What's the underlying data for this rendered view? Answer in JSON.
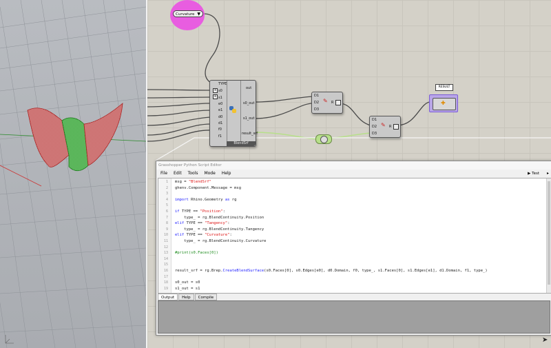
{
  "canvas": {
    "curvature_value": "Curvature",
    "result_label": "RESULT"
  },
  "blend_node": {
    "inputs": [
      "TYPE",
      "s0",
      "s1",
      "e0",
      "e1",
      "d0",
      "d1",
      "f0",
      "f1"
    ],
    "outputs": [
      "out",
      "s0_out",
      "s1_out",
      "result_srf"
    ],
    "message": "BlendSrf"
  },
  "dispatch_node_1": {
    "inputs": [
      "D1",
      "D2",
      "D3"
    ],
    "output": "R"
  },
  "dispatch_node_2": {
    "inputs": [
      "D1",
      "D2",
      "D3"
    ],
    "output": "R"
  },
  "editor": {
    "title": "Grasshopper Python Script Editor",
    "menu": [
      "File",
      "Edit",
      "Tools",
      "Mode",
      "Help"
    ],
    "test_label": "Test",
    "lines": [
      "msg = \"BlendSrf\"",
      "ghenv.Component.Message = msg",
      "",
      "import Rhino.Geometry as rg",
      "",
      "if TYPE == \"Position\":",
      "    type_ = rg.BlendContinuity.Position",
      "elif TYPE == \"Tangency\":",
      "    type_ = rg.BlendContinuity.Tangency",
      "elif TYPE == \"Curvature\":",
      "    type_ = rg.BlendContinuity.Curvature",
      "",
      "#print(s0.Faces[0])",
      "",
      "",
      "result_srf = rg.Brep.CreateBlendSurface(s0.Faces[0], s0.Edges[e0], d0.Domain, f0, type_, s1.Faces[0], s1.Edges[e1], d1.Domain, f1, type_)",
      "",
      "s0_out = s0",
      "s1_out = s1"
    ],
    "output_tabs": [
      "Output",
      "Help",
      "Compile"
    ]
  }
}
